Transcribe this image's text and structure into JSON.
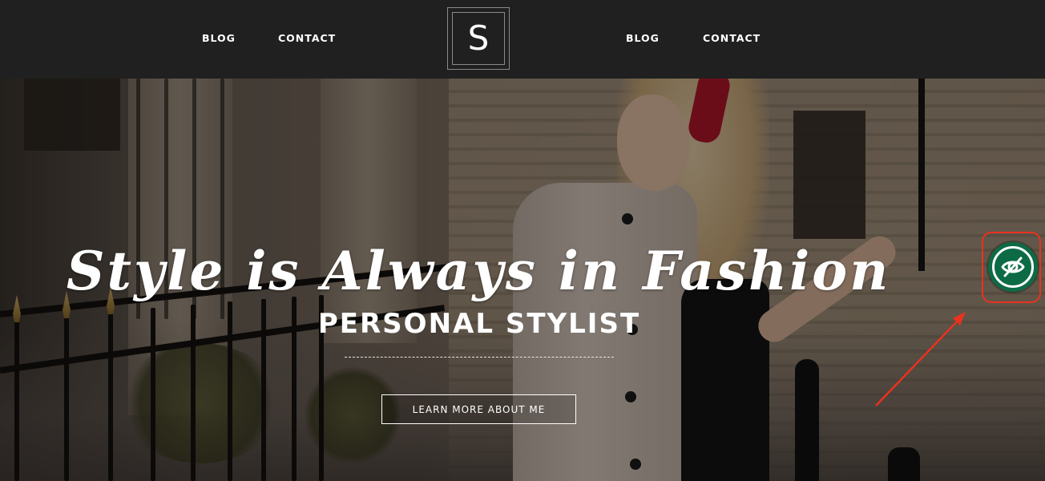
{
  "header": {
    "nav_left": [
      {
        "label": "BLOG"
      },
      {
        "label": "CONTACT"
      }
    ],
    "logo_letter": "S",
    "nav_right": [
      {
        "label": "BLOG"
      },
      {
        "label": "CONTACT"
      }
    ]
  },
  "hero": {
    "title": "Style is Always in Fashion",
    "subtitle": "PERSONAL STYLIST",
    "cta_label": "LEARN MORE ABOUT ME"
  },
  "widget": {
    "icon": "eye-slash-icon",
    "color": "#0c6b45",
    "highlight_color": "#e8321f"
  },
  "colors": {
    "header_bg": "#202020",
    "text": "#ffffff"
  }
}
